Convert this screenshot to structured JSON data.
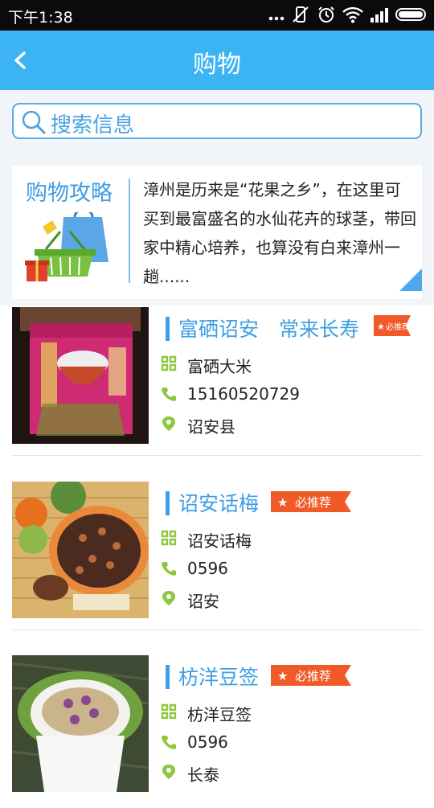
{
  "status_bar": {
    "time": "下午1:38"
  },
  "app_bar": {
    "title": "购物"
  },
  "search": {
    "placeholder": "搜索信息"
  },
  "guide": {
    "title": "购物攻略",
    "text": "漳州是历来是“花果之乡”，在这里可买到最富盛名的水仙花卉的球茎，带回家中精心培养，也算没有白来漳州一趟......"
  },
  "items": [
    {
      "name": "富硒诏安　常来长寿",
      "badge": "必推荐",
      "product": "富硒大米",
      "phone": "15160520729",
      "location": "诏安县"
    },
    {
      "name": "诏安话梅",
      "badge": "必推荐",
      "product": "诏安话梅",
      "phone": "0596",
      "location": "诏安"
    },
    {
      "name": "枋洋豆签",
      "badge": "必推荐",
      "product": "枋洋豆签",
      "phone": "0596",
      "location": "长泰"
    }
  ],
  "colors": {
    "accent": "#3cb4f3",
    "badge": "#f05a28",
    "icon_green": "#8dc63f"
  }
}
